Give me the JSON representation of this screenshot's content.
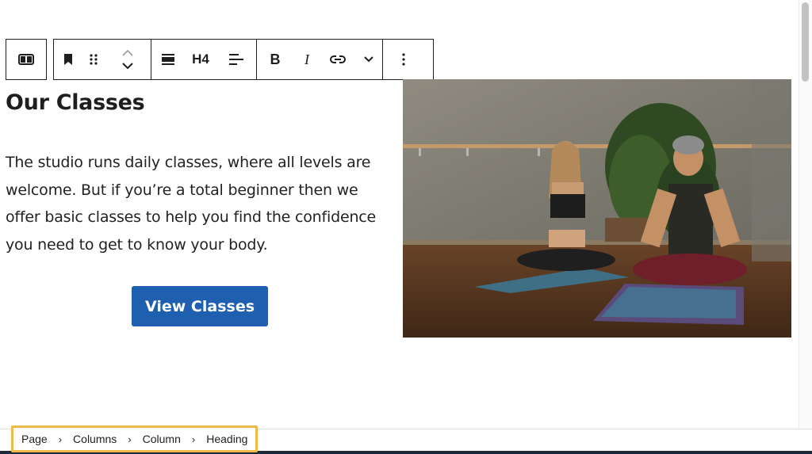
{
  "toolbar": {
    "column_icon": "columns-icon",
    "bookmark_icon": "bookmark-icon",
    "drag_icon": "drag-handle-icon",
    "move_up_icon": "chevron-up-icon",
    "move_down_icon": "chevron-down-icon",
    "align_icon": "align-wide-icon",
    "heading_level": "H4",
    "text_align_icon": "align-left-icon",
    "bold_label": "B",
    "italic_label": "I",
    "link_icon": "link-icon",
    "more_formats_icon": "chevron-down-icon",
    "options_icon": "more-vertical-icon"
  },
  "content": {
    "heading": "Our Classes",
    "paragraph": "The studio runs daily classes, where all levels are welcome. But if you’re a total beginner then we offer basic classes to help you find the confidence you need to get to know your body.",
    "button_label": "View Classes"
  },
  "breadcrumbs": {
    "items": [
      "Page",
      "Columns",
      "Column",
      "Heading"
    ],
    "separator": "›"
  },
  "colors": {
    "button": "#1f5fb0",
    "highlight": "#f0b849"
  }
}
